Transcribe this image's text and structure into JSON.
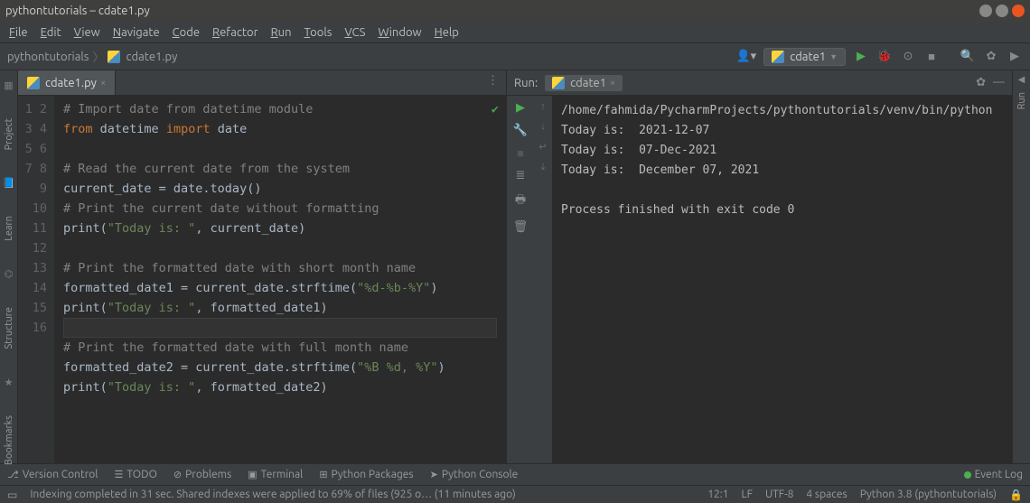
{
  "window": {
    "title": "pythontutorials – cdate1.py"
  },
  "menu": [
    "File",
    "Edit",
    "View",
    "Navigate",
    "Code",
    "Refactor",
    "Run",
    "Tools",
    "VCS",
    "Window",
    "Help"
  ],
  "breadcrumb": {
    "project": "pythontutorials",
    "file": "cdate1.py"
  },
  "runconfig": {
    "name": "cdate1"
  },
  "left_tools": [
    "Project",
    "Learn",
    "Structure",
    "Bookmarks"
  ],
  "editor": {
    "tab": "cdate1.py",
    "lines": [
      {
        "n": 1,
        "t": "comment",
        "txt": "# Import date from datetime module"
      },
      {
        "n": 2,
        "t": "import",
        "kw1": "from",
        "m": "datetime",
        "kw2": "import",
        "n2": "date"
      },
      {
        "n": 3,
        "t": "blank"
      },
      {
        "n": 4,
        "t": "comment",
        "txt": "# Read the current date from the system"
      },
      {
        "n": 5,
        "t": "assign",
        "lhs": "current_date",
        "rhs": "date.today()"
      },
      {
        "n": 6,
        "t": "comment",
        "txt": "# Print the current date without formatting"
      },
      {
        "n": 7,
        "t": "print",
        "str": "\"Today is: \"",
        "arg": "current_date"
      },
      {
        "n": 8,
        "t": "blank"
      },
      {
        "n": 9,
        "t": "comment",
        "txt": "# Print the formatted date with short month name"
      },
      {
        "n": 10,
        "t": "assign2",
        "lhs": "formatted_date1",
        "obj": "current_date",
        "fn": "strftime",
        "arg": "\"%d-%b-%Y\""
      },
      {
        "n": 11,
        "t": "print",
        "str": "\"Today is: \"",
        "arg": "formatted_date1"
      },
      {
        "n": 12,
        "t": "blank"
      },
      {
        "n": 13,
        "t": "comment",
        "txt": "# Print the formatted date with full month name"
      },
      {
        "n": 14,
        "t": "assign2",
        "lhs": "formatted_date2",
        "obj": "current_date",
        "fn": "strftime",
        "arg": "\"%B %d, %Y\""
      },
      {
        "n": 15,
        "t": "print",
        "str": "\"Today is: \"",
        "arg": "formatted_date2"
      },
      {
        "n": 16,
        "t": "blank"
      }
    ]
  },
  "run": {
    "label": "Run:",
    "tab": "cdate1",
    "output": "/home/fahmida/PycharmProjects/pythontutorials/venv/bin/python\nToday is:  2021-12-07\nToday is:  07-Dec-2021\nToday is:  December 07, 2021\n\nProcess finished with exit code 0"
  },
  "bottom_tools": {
    "vc": "Version Control",
    "todo": "TODO",
    "problems": "Problems",
    "terminal": "Terminal",
    "pypkg": "Python Packages",
    "pycon": "Python Console",
    "eventlog": "Event Log"
  },
  "status": {
    "msg": "Indexing completed in 31 sec. Shared indexes were applied to 69% of files (925 o… (11 minutes ago)",
    "pos": "12:1",
    "lf": "LF",
    "enc": "UTF-8",
    "indent": "4 spaces",
    "interp": "Python 3.8 (pythontutorials)"
  },
  "colors": {
    "close": "#e95420",
    "max": "#888",
    "min": "#888"
  }
}
